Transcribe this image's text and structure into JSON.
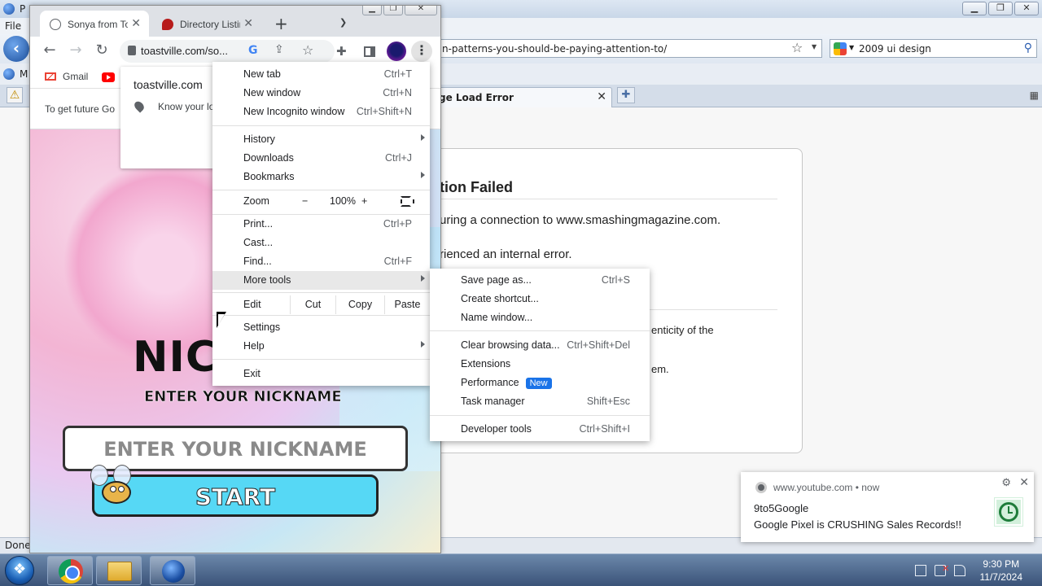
{
  "firefox": {
    "title_initial": "P",
    "menu_file": "File",
    "bookmark_initial": "M",
    "url": "n-patterns-you-should-be-paying-attention-to/",
    "search_value": "2009 ui design",
    "tab_title": "ge Load Error",
    "status": "Done",
    "error": {
      "title": "tion Failed",
      "line1": "uring a connection to www.smashingmagazine.com.",
      "line2": "rienced an internal error.",
      "line3": "enticity of the",
      "line4": "em."
    }
  },
  "chrome": {
    "tabs": [
      {
        "label": "Sonya from Toastville",
        "icon": "globe-icon"
      },
      {
        "label": "Directory Listing",
        "icon": "site-favicon"
      }
    ],
    "url": "toastville.com/so...",
    "bookmarks": [
      {
        "label": "Gmail",
        "icon": "gmail-icon"
      },
      {
        "label": "",
        "icon": "youtube-icon"
      }
    ],
    "infobar_text": "To get future Go",
    "site_popup": {
      "title": "toastville.com",
      "permission": "Know your lo"
    },
    "page": {
      "logo": "NIC",
      "subtitle": "ENTER YOUR NICKNAME",
      "nickname_placeholder": "ENTER YOUR NICKNAME",
      "start_label": "START"
    },
    "menu": {
      "new_tab": {
        "label": "New tab",
        "shortcut": "Ctrl+T"
      },
      "new_window": {
        "label": "New window",
        "shortcut": "Ctrl+N"
      },
      "new_incognito": {
        "label": "New Incognito window",
        "shortcut": "Ctrl+Shift+N"
      },
      "history": {
        "label": "History"
      },
      "downloads": {
        "label": "Downloads",
        "shortcut": "Ctrl+J"
      },
      "bookmarks": {
        "label": "Bookmarks"
      },
      "zoom": {
        "label": "Zoom",
        "minus": "−",
        "value": "100%",
        "plus": "+"
      },
      "print": {
        "label": "Print...",
        "shortcut": "Ctrl+P"
      },
      "cast": {
        "label": "Cast..."
      },
      "find": {
        "label": "Find...",
        "shortcut": "Ctrl+F"
      },
      "more_tools": {
        "label": "More tools"
      },
      "edit": {
        "label": "Edit",
        "cut": "Cut",
        "copy": "Copy",
        "paste": "Paste"
      },
      "settings": {
        "label": "Settings"
      },
      "help": {
        "label": "Help"
      },
      "exit": {
        "label": "Exit"
      }
    },
    "more_tools_menu": {
      "save_page": {
        "label": "Save page as...",
        "shortcut": "Ctrl+S"
      },
      "create_shortcut": {
        "label": "Create shortcut..."
      },
      "name_window": {
        "label": "Name window..."
      },
      "clear_browsing": {
        "label": "Clear browsing data...",
        "shortcut": "Ctrl+Shift+Del"
      },
      "extensions": {
        "label": "Extensions"
      },
      "performance": {
        "label": "Performance",
        "badge": "New"
      },
      "task_manager": {
        "label": "Task manager",
        "shortcut": "Shift+Esc"
      },
      "developer_tools": {
        "label": "Developer tools",
        "shortcut": "Ctrl+Shift+I"
      }
    }
  },
  "notification": {
    "source": "www.youtube.com • now",
    "title": "9to5Google",
    "body": "Google Pixel is CRUSHING Sales Records!!"
  },
  "taskbar": {
    "time": "9:30 PM",
    "date": "11/7/2024"
  },
  "colors": {
    "accent": "#1a73e8",
    "start_button": "#56d8f5",
    "taskbar": "#4a6489"
  }
}
